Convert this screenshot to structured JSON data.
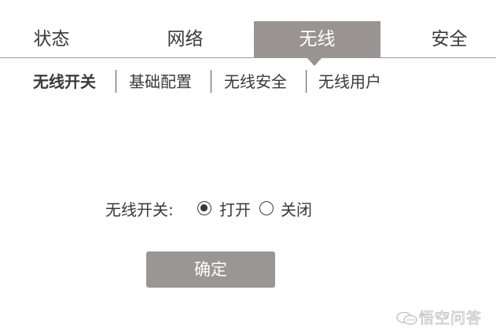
{
  "main_tabs": [
    {
      "label": "状态",
      "active": false
    },
    {
      "label": "网络",
      "active": false
    },
    {
      "label": "无线",
      "active": true
    },
    {
      "label": "安全",
      "active": false
    }
  ],
  "sub_tabs": [
    {
      "label": "无线开关",
      "active": true
    },
    {
      "label": "基础配置",
      "active": false
    },
    {
      "label": "无线安全",
      "active": false
    },
    {
      "label": "无线用户",
      "active": false
    }
  ],
  "wifi_switch": {
    "label": "无线开关:",
    "options": [
      {
        "label": "打开",
        "selected": true
      },
      {
        "label": "关闭",
        "selected": false
      }
    ]
  },
  "confirm_button": {
    "label": "确定"
  },
  "watermark": {
    "text": "悟空问答",
    "icon": "chat-bubbles-logo"
  },
  "colors": {
    "active_tab_bg": "#999393",
    "button_bg": "#999696",
    "text": "#3a3a3a",
    "divider": "#9a9a9a"
  }
}
